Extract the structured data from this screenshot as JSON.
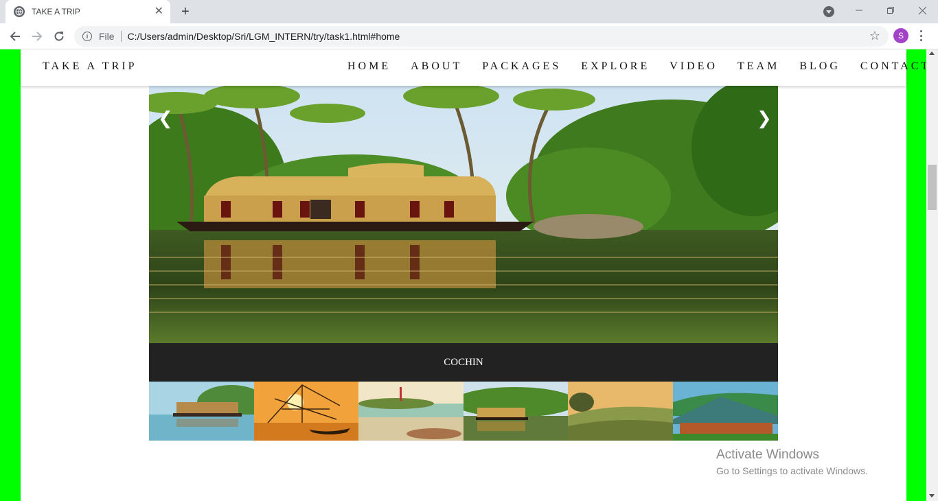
{
  "browser": {
    "tab_title": "TAKE A TRIP",
    "new_tab": "+",
    "tab_close": "✕",
    "address_scheme_label": "File",
    "url": "C:/Users/admin/Desktop/Sri/LGM_INTERN/try/task1.html#home",
    "profile_initial": "S",
    "icons": [
      "globe-icon",
      "close-icon",
      "plus-icon",
      "back-icon",
      "forward-icon",
      "reload-icon",
      "info-icon",
      "star-icon",
      "menu-icon"
    ]
  },
  "site": {
    "brand": "TAKE A TRIP",
    "nav": [
      "HOME",
      "ABOUT",
      "PACKAGES",
      "EXPLORE",
      "VIDEO",
      "TEAM",
      "BLOG",
      "CONTACT"
    ]
  },
  "slideshow": {
    "prev_arrow": "❮",
    "next_arrow": "❯",
    "caption": "COCHIN",
    "thumbnails": [
      "houseboat-backwater",
      "chinese-fishing-nets-sunset",
      "kovalam-beach",
      "houseboat-palms",
      "tea-plantation-hills",
      "thatched-cottages"
    ]
  },
  "os_watermark": {
    "line1": "Activate Windows",
    "line2": "Go to Settings to activate Windows."
  },
  "colors": {
    "page_bg": "#00ff00",
    "caption_bg": "#222222",
    "profile": "#a142c8"
  }
}
